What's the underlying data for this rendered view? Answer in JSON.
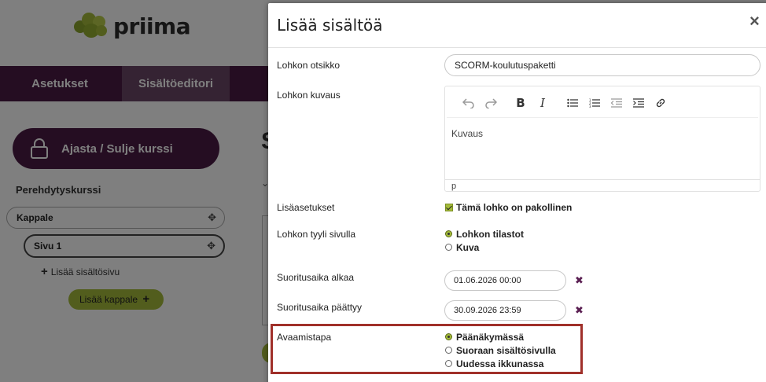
{
  "app": {
    "logo_text": "priima",
    "nav": {
      "settings_tab": "Asetukset",
      "content_editor_tab": "Sisältöeditori"
    },
    "sidebar": {
      "schedule_button": "Ajasta / Sulje kurssi",
      "course_title": "Perehdytyskurssi",
      "chapter_label": "Kappale",
      "page_label": "Sivu 1",
      "add_content_page": "Lisää sisältösivu",
      "add_chapter": "Lisää kappale"
    },
    "main_partial_title": "S"
  },
  "modal": {
    "title": "Lisää sisältöä",
    "close_label": "×",
    "block_title": {
      "label": "Lohkon otsikko",
      "value": "SCORM-koulutuspaketti"
    },
    "block_description": {
      "label": "Lohkon kuvaus",
      "content": "Kuvaus",
      "status_path": "p",
      "toolbar": [
        "undo-icon",
        "redo-icon",
        "bold-icon",
        "italic-icon",
        "bullet-list-icon",
        "numbered-list-icon",
        "outdent-icon",
        "indent-icon",
        "link-icon"
      ]
    },
    "extra_settings": {
      "label": "Lisäasetukset",
      "checkbox_label": "Tämä lohko on pakollinen",
      "checked": true
    },
    "block_style": {
      "label": "Lohkon tyyli sivulla",
      "options": [
        {
          "label": "Lohkon tilastot",
          "selected": true
        },
        {
          "label": "Kuva",
          "selected": false
        }
      ]
    },
    "start_time": {
      "label": "Suoritusaika alkaa",
      "value": "01.06.2026 00:00",
      "clear": "✖"
    },
    "end_time": {
      "label": "Suoritusaika päättyy",
      "value": "30.09.2026 23:59",
      "clear": "✖"
    },
    "open_mode": {
      "label": "Avaamistapa",
      "options": [
        {
          "label": "Päänäkymässä",
          "selected": true
        },
        {
          "label": "Suoraan sisältösivulla",
          "selected": false
        },
        {
          "label": "Uudessa ikkunassa",
          "selected": false
        }
      ]
    }
  },
  "colors": {
    "brand_purple": "#4a1b44",
    "accent_green": "#a4bb3a",
    "highlight_red": "#a0302a"
  }
}
